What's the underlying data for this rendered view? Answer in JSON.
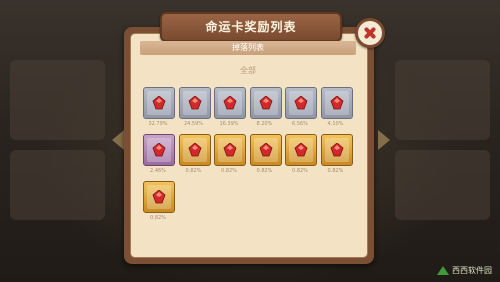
{
  "dialog": {
    "title": "命运卡奖励列表",
    "subheader": "掉落列表",
    "section_label": "全部"
  },
  "rewards": [
    {
      "percent": "32.79%",
      "frame": "gray"
    },
    {
      "percent": "24.59%",
      "frame": "gray"
    },
    {
      "percent": "16.39%",
      "frame": "gray"
    },
    {
      "percent": "8.20%",
      "frame": "gray"
    },
    {
      "percent": "6.56%",
      "frame": "gray"
    },
    {
      "percent": "4.10%",
      "frame": "gray"
    },
    {
      "percent": "2.46%",
      "frame": "purple"
    },
    {
      "percent": "0.82%",
      "frame": "gold"
    },
    {
      "percent": "0.82%",
      "frame": "gold"
    },
    {
      "percent": "0.82%",
      "frame": "gold"
    },
    {
      "percent": "0.82%",
      "frame": "gold"
    },
    {
      "percent": "0.82%",
      "frame": "gold"
    },
    {
      "percent": "0.82%",
      "frame": "gold"
    }
  ],
  "watermark": "西西软件园",
  "colors": {
    "panel": "#7b4f33",
    "parchment": "#f3e3c4",
    "gem": "#d22a2a",
    "close_x": "#c0352a"
  }
}
